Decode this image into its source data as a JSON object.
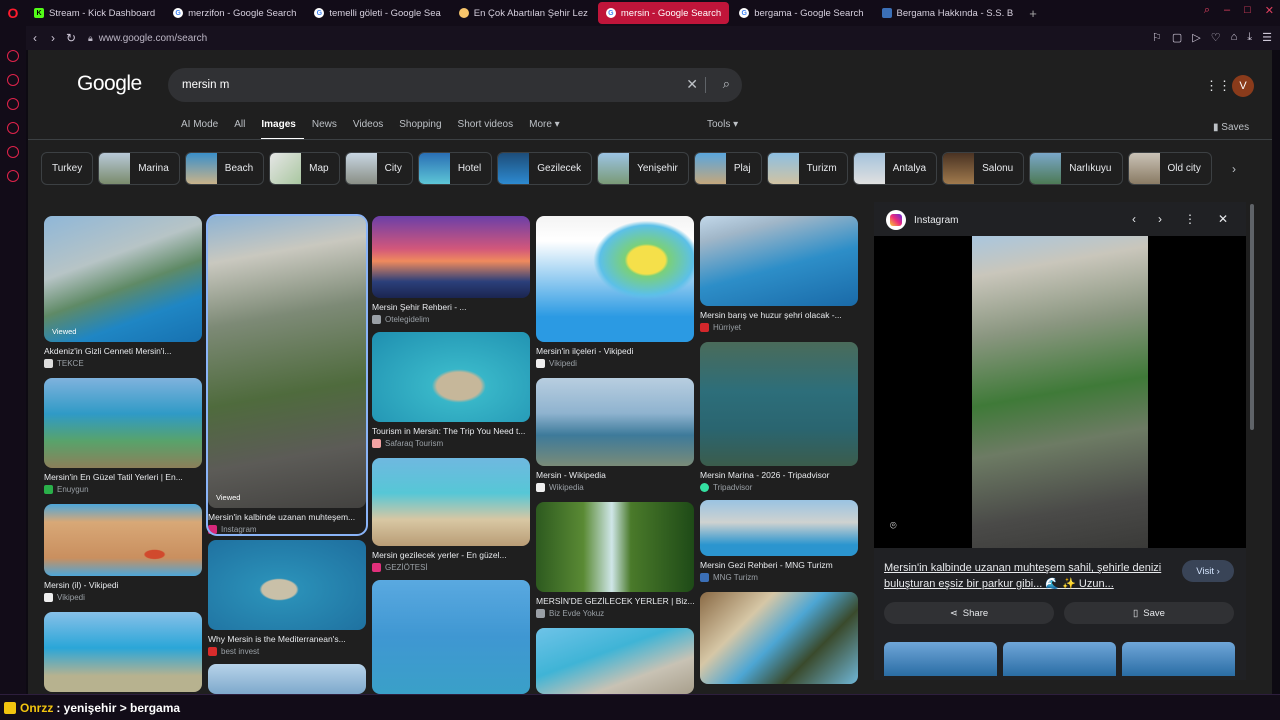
{
  "browser": {
    "tabs": [
      {
        "label": "Stream - Kick Dashboard",
        "icon": "kick-icon"
      },
      {
        "label": "merzifon - Google Search",
        "icon": "google-icon"
      },
      {
        "label": "temelli göleti - Google Sea",
        "icon": "google-icon"
      },
      {
        "label": "En Çok Abartılan Şehir Lez",
        "icon": "eksi-icon"
      },
      {
        "label": "mersin - Google Search",
        "icon": "google-icon",
        "active": true
      },
      {
        "label": "bergama - Google Search",
        "icon": "google-icon"
      },
      {
        "label": "Bergama Hakkında - S.S. B",
        "icon": "site-icon"
      }
    ],
    "url": "www.google.com/search"
  },
  "google": {
    "logo": "Google",
    "query": "mersin m",
    "avatar_letter": "V",
    "tabs": [
      "AI Mode",
      "All",
      "Images",
      "News",
      "Videos",
      "Shopping",
      "Short videos",
      "More ▾"
    ],
    "active_tab": "Images",
    "tools": "Tools ▾",
    "saves": "Saves",
    "chips": [
      "Turkey",
      "Marina",
      "Beach",
      "Map",
      "City",
      "Hotel",
      "Gezilecek",
      "Yenişehir",
      "Plaj",
      "Turizm",
      "Antalya",
      "Salonu",
      "Narlıkuyu",
      "Old city"
    ]
  },
  "results": [
    {
      "title": "Akdeniz'in Gizli Cenneti Mersin'i...",
      "source": "TEKCE",
      "viewed": "Viewed"
    },
    {
      "title": "Mersin'in En Güzel Tatil Yerleri | En...",
      "source": "Enuygun"
    },
    {
      "title": "Mersin (il) - Vikipedi",
      "source": "Vikipedi"
    },
    {
      "title": "Mersin'in kalbinde uzanan muhteşem...",
      "source": "Instagram",
      "viewed": "Viewed"
    },
    {
      "title": "Why Mersin is the Mediterranean's...",
      "source": "best invest"
    },
    {
      "title": "Mersin Şehir Rehberi - ...",
      "source": "Otelegidelim"
    },
    {
      "title": "Tourism in Mersin: The Trip You Need t...",
      "source": "Safaraq Tourism"
    },
    {
      "title": "Mersin gezilecek yerler - En güzel...",
      "source": "GEZİÖTESİ"
    },
    {
      "title": "Mersin'in ilçeleri - Vikipedi",
      "source": "Vikipedi"
    },
    {
      "title": "Mersin - Wikipedia",
      "source": "Wikipedia"
    },
    {
      "title": "MERSİN'DE GEZİLECEK YERLER | Biz...",
      "source": "Biz Evde Yokuz"
    },
    {
      "title": "Mersin barış ve huzur şehri olacak -...",
      "source": "Hürriyet"
    },
    {
      "title": "Mersin Marina - 2026 - Tripadvisor",
      "source": "Tripadvisor"
    },
    {
      "title": "Mersin Gezi Rehberi - MNG Turizm",
      "source": "MNG Turizm"
    }
  ],
  "preview": {
    "source": "Instagram",
    "title": "Mersin'in kalbinde uzanan muhteşem sahil, şehirle denizi buluşturan eşsiz bir parkur gibi... 🌊 ✨ Uzun...",
    "visit": "Visit ›",
    "share": "Share",
    "save": "Save"
  },
  "overlay": {
    "user": "Onrzz",
    "message": ": yenişehir > bergama"
  }
}
